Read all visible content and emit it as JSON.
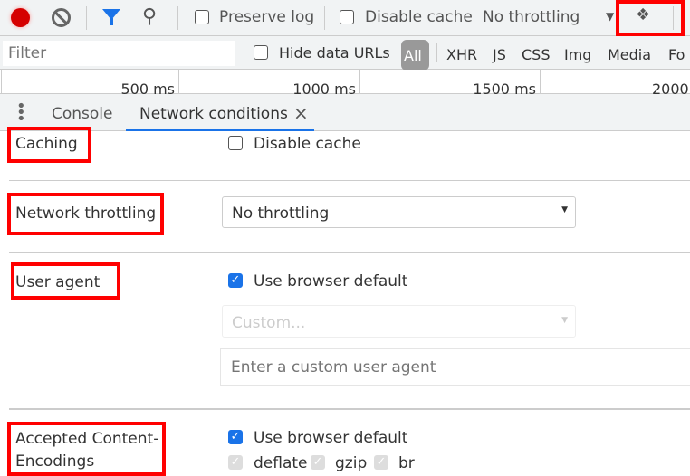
{
  "toolbar": {
    "record_icon": "record-icon",
    "clear_icon": "clear-icon",
    "filter_icon": "filter-icon",
    "search_icon": "search-icon",
    "preserve_log": "Preserve log",
    "disable_cache": "Disable cache",
    "throttling": "No throttling",
    "network_conditions_icon": "wifi-gear-icon"
  },
  "filterbar": {
    "filter_placeholder": "Filter",
    "hide_data_urls": "Hide data URLs",
    "types": [
      "All",
      "XHR",
      "JS",
      "CSS",
      "Img",
      "Media",
      "Fo"
    ]
  },
  "timeline": {
    "ticks": [
      "500 ms",
      "1000 ms",
      "1500 ms",
      "2000"
    ]
  },
  "drawer": {
    "tabs": [
      {
        "label": "Console",
        "active": false
      },
      {
        "label": "Network conditions",
        "active": true
      }
    ],
    "close": "×"
  },
  "conditions": {
    "caching": {
      "label": "Caching",
      "checkbox": "Disable cache",
      "checked": false
    },
    "throttling": {
      "label": "Network throttling",
      "value": "No throttling"
    },
    "user_agent": {
      "label": "User agent",
      "checkbox": "Use browser default",
      "checked": true,
      "select": "Custom...",
      "input_placeholder": "Enter a custom user agent"
    },
    "encodings": {
      "label_line1": "Accepted Content-",
      "label_line2": "Encodings",
      "checkbox": "Use browser default",
      "checked": true,
      "options": [
        "deflate",
        "gzip",
        "br"
      ]
    }
  },
  "colors": {
    "accent": "#1a73e8",
    "record": "#d50000",
    "highlight": "#ff0000"
  }
}
